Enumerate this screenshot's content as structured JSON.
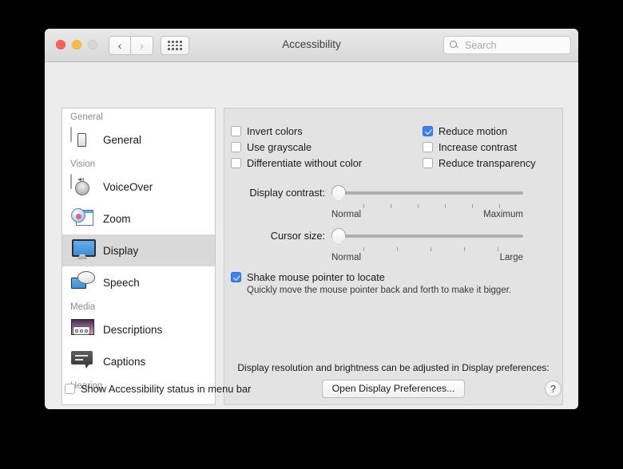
{
  "window": {
    "title": "Accessibility",
    "traffic_lights": [
      "close",
      "minimize",
      "zoom"
    ],
    "nav_back": "‹",
    "nav_forward": "›",
    "grid_button": "show-all-icon"
  },
  "search": {
    "placeholder": "Search",
    "value": "",
    "icon": "search-icon"
  },
  "sidebar": {
    "groups": [
      {
        "label": "General",
        "items": [
          {
            "label": "General",
            "icon": "general-icon",
            "selected": false
          }
        ]
      },
      {
        "label": "Vision",
        "items": [
          {
            "label": "VoiceOver",
            "icon": "voiceover-icon",
            "selected": false
          },
          {
            "label": "Zoom",
            "icon": "zoom-icon",
            "selected": false
          },
          {
            "label": "Display",
            "icon": "display-icon",
            "selected": true
          },
          {
            "label": "Speech",
            "icon": "speech-icon",
            "selected": false
          }
        ]
      },
      {
        "label": "Media",
        "items": [
          {
            "label": "Descriptions",
            "icon": "descriptions-icon",
            "selected": false
          },
          {
            "label": "Captions",
            "icon": "captions-icon",
            "selected": false
          }
        ]
      },
      {
        "label": "Hearing",
        "items": []
      }
    ]
  },
  "panel": {
    "checkboxes": [
      {
        "label": "Invert colors",
        "checked": false,
        "column": "left"
      },
      {
        "label": "Reduce motion",
        "checked": true,
        "column": "right"
      },
      {
        "label": "Use grayscale",
        "checked": false,
        "column": "left"
      },
      {
        "label": "Increase contrast",
        "checked": false,
        "column": "right"
      },
      {
        "label": "Differentiate without color",
        "checked": false,
        "column": "left"
      },
      {
        "label": "Reduce transparency",
        "checked": false,
        "column": "right"
      }
    ],
    "sliders": [
      {
        "label": "Display contrast:",
        "min_label": "Normal",
        "max_label": "Maximum",
        "value_percent": 0,
        "tick_count": 6
      },
      {
        "label": "Cursor size:",
        "min_label": "Normal",
        "max_label": "Large",
        "value_percent": 0,
        "tick_count": 5
      }
    ],
    "shake": {
      "label": "Shake mouse pointer to locate",
      "checked": true,
      "description": "Quickly move the mouse pointer back and forth to make it bigger."
    },
    "resolution_note": "Display resolution and brightness can be adjusted in Display preferences:",
    "open_prefs_button": "Open Display Preferences..."
  },
  "footer": {
    "menu_bar_checkbox": {
      "label": "Show Accessibility status in menu bar",
      "checked": false
    },
    "help_button": "?"
  },
  "colors": {
    "accent": "#3a82f7",
    "selection": "#d9d9d9",
    "window_bg": "#ececec",
    "panel_bg": "#e3e3e3"
  }
}
